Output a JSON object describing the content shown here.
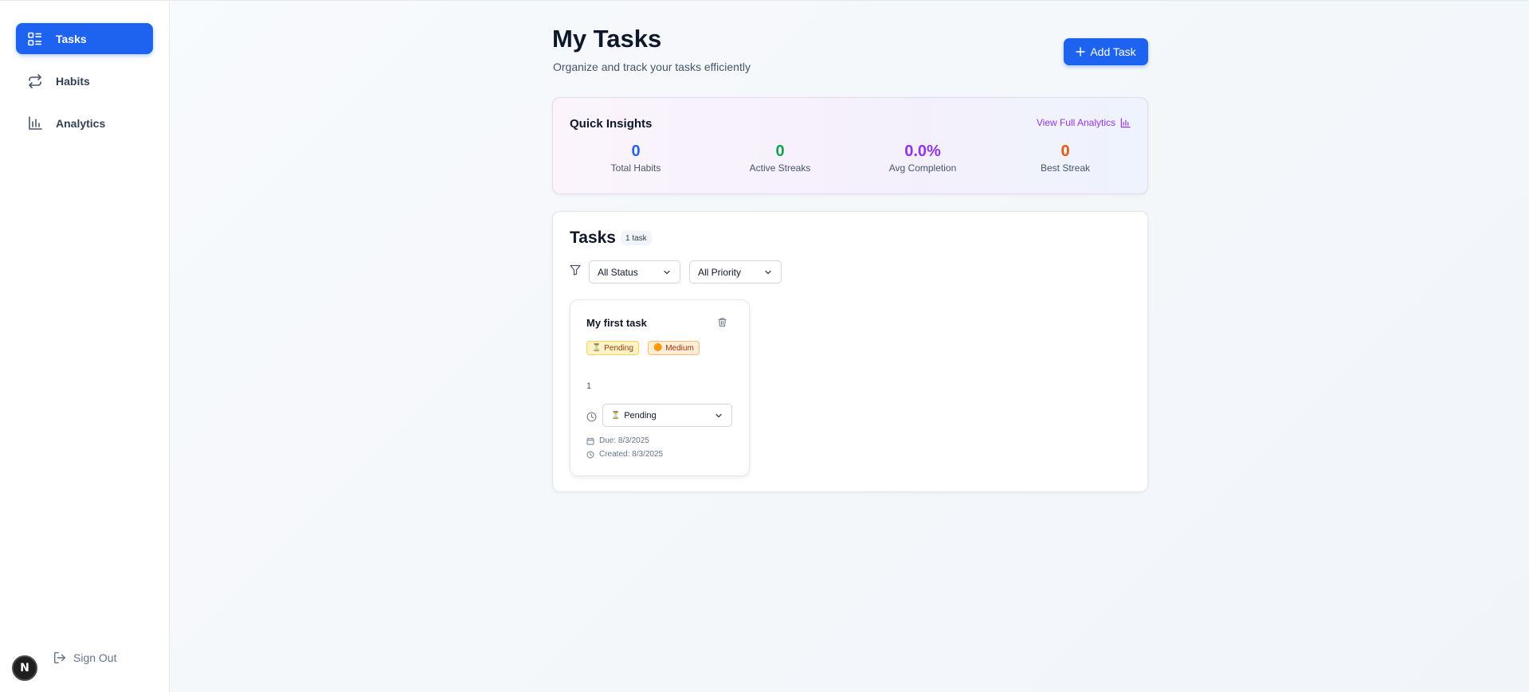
{
  "sidebar": {
    "items": [
      {
        "label": "Tasks",
        "icon": "list-icon",
        "active": true
      },
      {
        "label": "Habits",
        "icon": "repeat-icon",
        "active": false
      },
      {
        "label": "Analytics",
        "icon": "bar-chart-icon",
        "active": false
      }
    ],
    "sign_out_label": "Sign Out",
    "avatar_letter": "N"
  },
  "header": {
    "title": "My Tasks",
    "subtitle": "Organize and track your tasks efficiently",
    "add_task_label": "Add Task"
  },
  "insights": {
    "title": "Quick Insights",
    "link_label": "View Full Analytics",
    "stats": [
      {
        "value": "0",
        "label": "Total Habits",
        "color": "#2563eb"
      },
      {
        "value": "0",
        "label": "Active Streaks",
        "color": "#16a34a"
      },
      {
        "value": "0.0%",
        "label": "Avg Completion",
        "color": "#9333ea"
      },
      {
        "value": "0",
        "label": "Best Streak",
        "color": "#ea580c"
      }
    ]
  },
  "tasks": {
    "title": "Tasks",
    "count_badge": "1 task",
    "filters": {
      "status_value": "All Status",
      "priority_value": "All Priority"
    },
    "items": [
      {
        "name": "My first task",
        "status_badge": "Pending",
        "status_badge_emoji": "⏳",
        "priority_badge": "Medium",
        "priority_badge_emoji": "🟠",
        "description": "1",
        "status_select_value": "Pending",
        "status_select_emoji": "⏳",
        "due": "Due: 8/3/2025",
        "created": "Created: 8/3/2025"
      }
    ]
  },
  "colors": {
    "primary": "#1d63f0",
    "insights_link": "#9333ea"
  }
}
